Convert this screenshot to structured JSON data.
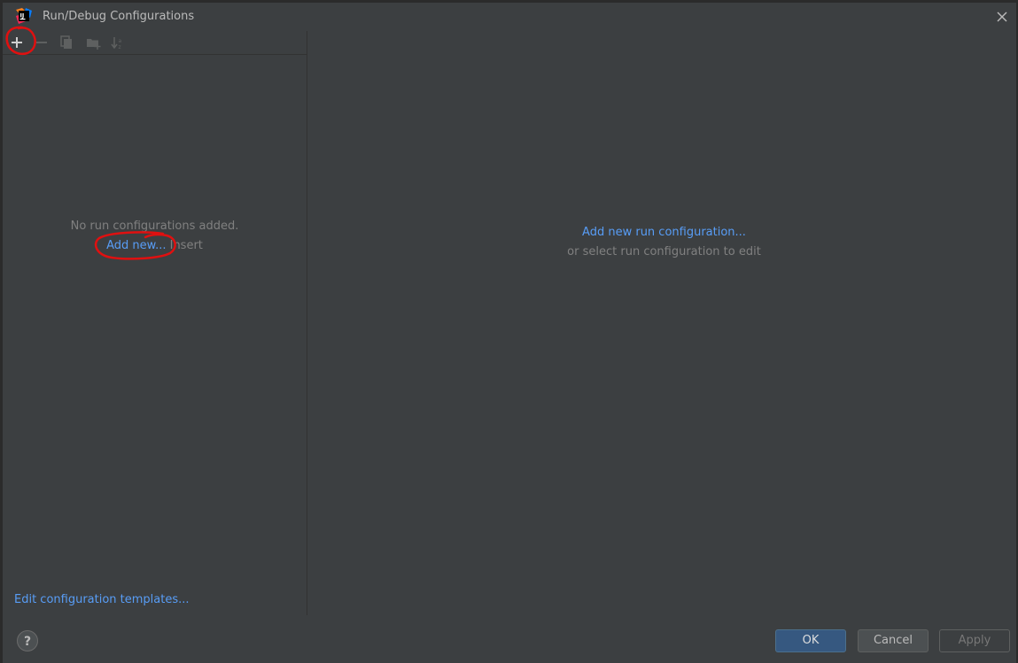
{
  "window": {
    "title": "Run/Debug Configurations"
  },
  "toolbar": {
    "buttons": [
      {
        "name": "add",
        "icon": "plus-icon",
        "enabled": true
      },
      {
        "name": "remove",
        "icon": "minus-icon",
        "enabled": false
      },
      {
        "name": "copy",
        "icon": "copy-icon",
        "enabled": false
      },
      {
        "name": "move-to-folder",
        "icon": "folder-add-icon",
        "enabled": false
      },
      {
        "name": "sort",
        "icon": "sort-icon",
        "enabled": false
      }
    ]
  },
  "left_panel": {
    "empty_message": "No run configurations added.",
    "add_new_link": "Add new...",
    "add_new_shortcut": "Insert",
    "edit_templates_link": "Edit configuration templates..."
  },
  "right_panel": {
    "add_link": "Add new run configuration...",
    "hint": "or select run configuration to edit"
  },
  "footer": {
    "help_label": "?",
    "ok_label": "OK",
    "cancel_label": "Cancel",
    "apply_label": "Apply"
  },
  "colors": {
    "background": "#3c3f41",
    "link": "#589df6",
    "muted_text": "#808080",
    "ok_button": "#365880",
    "annotation": "#e01010"
  }
}
